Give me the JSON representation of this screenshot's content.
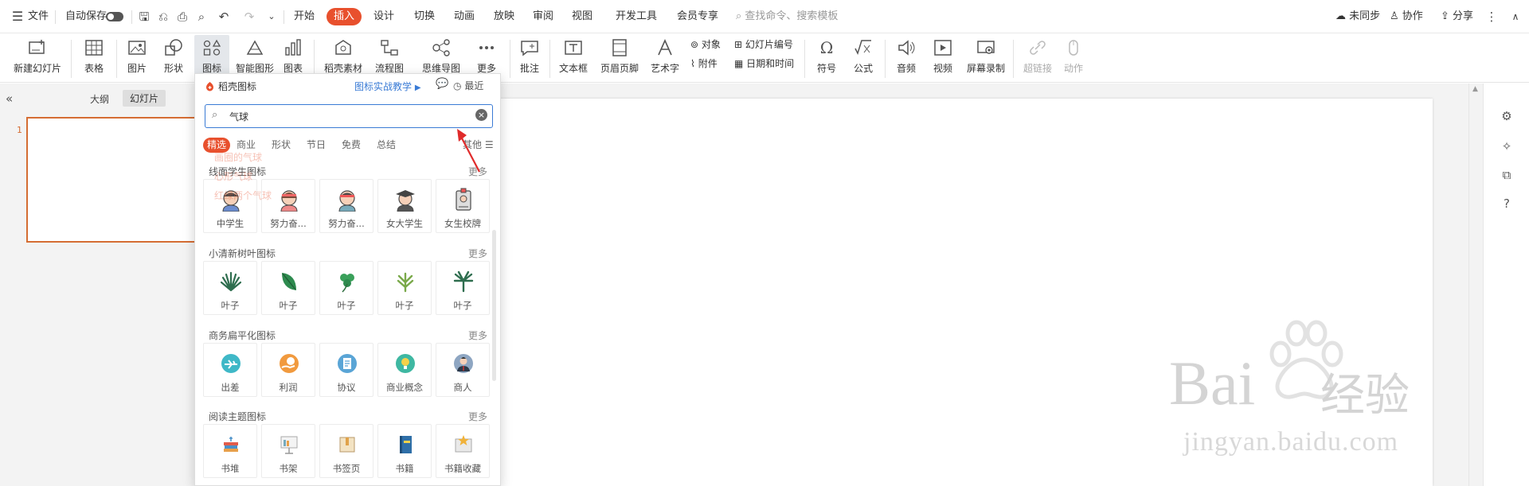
{
  "menubar": {
    "file_label": "文件",
    "autosave_label": "自动保存",
    "tabs": [
      {
        "label": "开始"
      },
      {
        "label": "插入",
        "active": true
      },
      {
        "label": "设计"
      },
      {
        "label": "切换"
      },
      {
        "label": "动画"
      },
      {
        "label": "放映"
      },
      {
        "label": "审阅"
      },
      {
        "label": "视图"
      },
      {
        "label": "开发工具"
      },
      {
        "label": "会员专享"
      }
    ],
    "search_placeholder": "查找命令、搜索模板",
    "sync_label": "未同步",
    "collab_label": "协作",
    "share_label": "分享"
  },
  "ribbon": {
    "new_slide": "新建幻灯片",
    "table": "表格",
    "picture": "图片",
    "shape": "形状",
    "icon": "图标",
    "smart_shape": "智能图形",
    "chart": "图表",
    "material": "稻壳素材",
    "flowchart": "流程图",
    "mindmap": "思维导图",
    "more": "更多",
    "comment": "批注",
    "textbox": "文本框",
    "header_footer": "页眉页脚",
    "wordart": "艺术字",
    "object": "对象",
    "slide_number": "幻灯片编号",
    "attachment": "附件",
    "datetime": "日期和时间",
    "symbol": "符号",
    "formula": "公式",
    "audio": "音频",
    "video": "视频",
    "screen_record": "屏幕录制",
    "hyperlink": "超链接",
    "action": "动作"
  },
  "left_panel": {
    "tab_outline": "大纲",
    "tab_slides": "幻灯片",
    "slide_number": "1"
  },
  "icon_panel": {
    "title": "稻壳图标",
    "tutorial_link": "图标实战教学",
    "recent_label": "最近",
    "search_value": "气球",
    "filters": [
      "精选",
      "商业",
      "形状",
      "节日",
      "免费",
      "总结"
    ],
    "other_label": "其他",
    "more_label": "更多",
    "suggestions": [
      "画圈的气球",
      "心形气球",
      "红绿两个气球"
    ],
    "sections": [
      {
        "title": "线面学生图标",
        "items": [
          "中学生",
          "努力奋...",
          "努力奋...",
          "女大学生",
          "女生校牌"
        ]
      },
      {
        "title": "小清新树叶图标",
        "items": [
          "叶子",
          "叶子",
          "叶子",
          "叶子",
          "叶子"
        ]
      },
      {
        "title": "商务扁平化图标",
        "items": [
          "出差",
          "利润",
          "协议",
          "商业概念",
          "商人"
        ]
      },
      {
        "title": "阅读主题图标",
        "items": [
          "书堆",
          "书架",
          "书签页",
          "书籍",
          "书籍收藏"
        ]
      }
    ]
  },
  "watermark": {
    "brand": "Bai",
    "brand_cn": "经验",
    "url": "jingyan.baidu.com"
  }
}
